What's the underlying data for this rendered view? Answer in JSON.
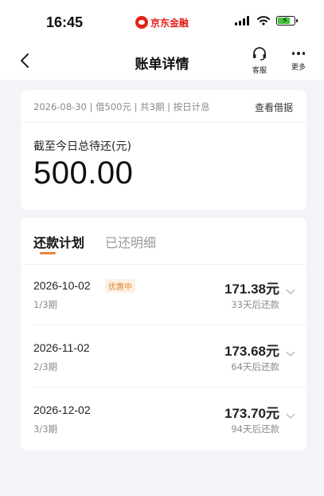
{
  "status_bar": {
    "time": "16:45",
    "app_badge": "京东金融"
  },
  "nav": {
    "title": "账单详情",
    "service_label": "客服",
    "more_label": "更多"
  },
  "summary": {
    "loan_info": "2026-08-30 | 借500元 | 共3期 | 按日计息",
    "view_contract": "查看借据",
    "due_label": "截至今日总待还(元)",
    "due_amount": "500.00"
  },
  "tabs": [
    {
      "label": "还款计划",
      "active": true
    },
    {
      "label": "已还明细",
      "active": false
    }
  ],
  "plan": [
    {
      "date": "2026-10-02",
      "tag": "优惠中",
      "period": "1/3期",
      "amount": "171.38元",
      "countdown": "33天后还款"
    },
    {
      "date": "2026-11-02",
      "tag": "",
      "period": "2/3期",
      "amount": "173.68元",
      "countdown": "64天后还款"
    },
    {
      "date": "2026-12-02",
      "tag": "",
      "period": "3/3期",
      "amount": "173.70元",
      "countdown": "94天后还款"
    }
  ],
  "colors": {
    "accent": "#e8833a",
    "brand": "#e2231a",
    "background": "#f3f4f8"
  },
  "icons": {
    "back": "back-arrow-icon",
    "service": "headset-icon",
    "more": "more-dots-icon",
    "chevron": "chevron-down-icon"
  }
}
